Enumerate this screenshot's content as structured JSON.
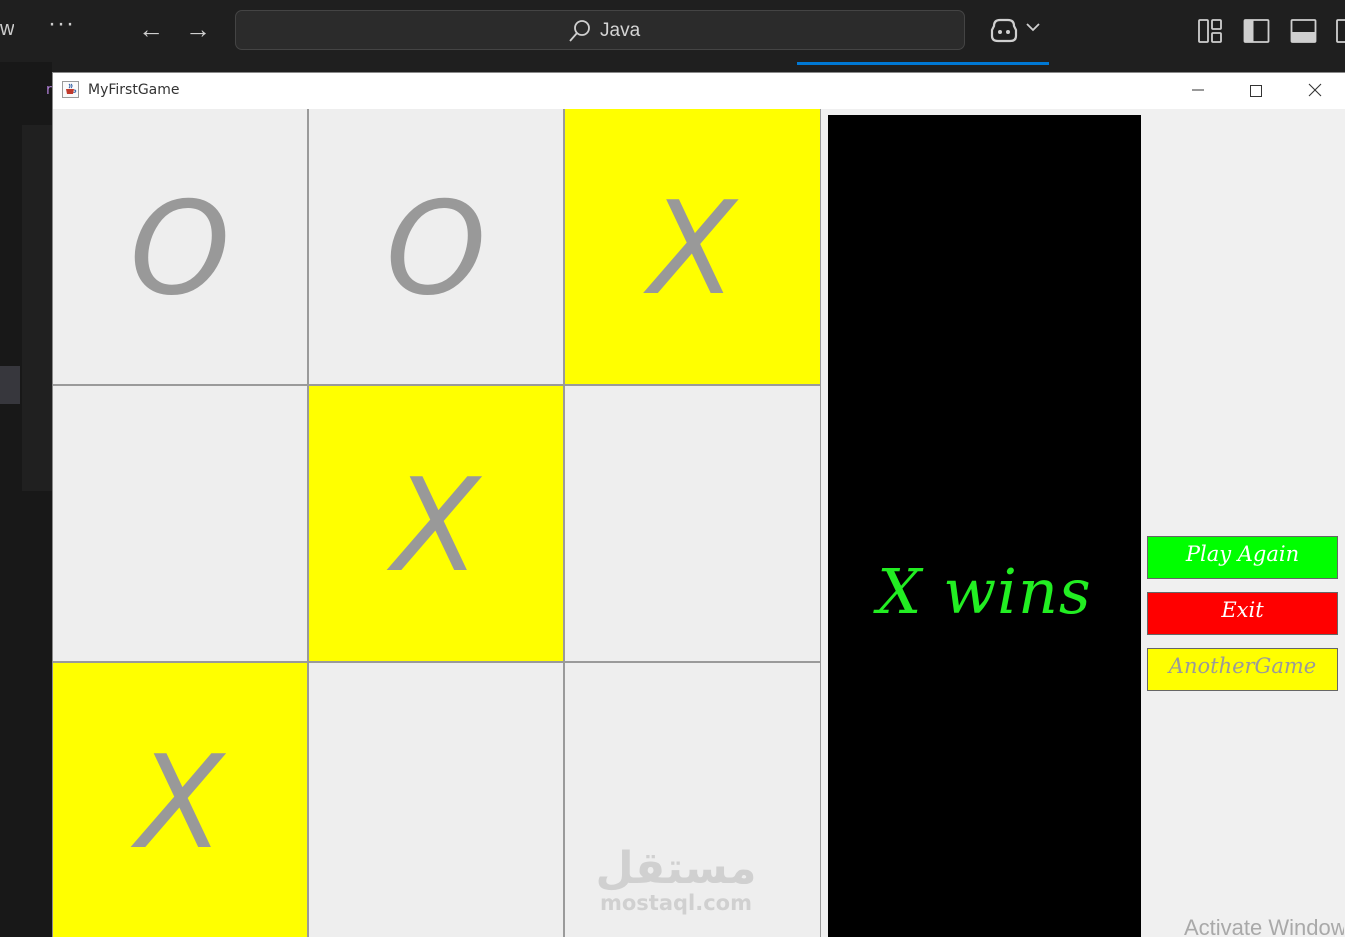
{
  "ide": {
    "menu_partial": "w",
    "more": "···",
    "back_arrow": "←",
    "forward_arrow": "→",
    "search_text": "Java",
    "menu_partial_right": "r"
  },
  "window": {
    "title": "MyFirstGame"
  },
  "board": {
    "cells": [
      {
        "mark": "O",
        "highlight": false
      },
      {
        "mark": "O",
        "highlight": false
      },
      {
        "mark": "X",
        "highlight": true
      },
      {
        "mark": "",
        "highlight": false
      },
      {
        "mark": "X",
        "highlight": true
      },
      {
        "mark": "",
        "highlight": false
      },
      {
        "mark": "X",
        "highlight": true
      },
      {
        "mark": "",
        "highlight": false
      },
      {
        "mark": "",
        "highlight": false
      }
    ],
    "highlight_color": "#ffff00",
    "empty_color": "#eeeeee",
    "mark_color": "#999999"
  },
  "result": {
    "text": "X wins",
    "text_color": "#22ee22",
    "background": "#000000"
  },
  "buttons": {
    "play_again": {
      "label": "Play Again",
      "bg": "#00ff00",
      "fg": "#ffffff"
    },
    "exit": {
      "label": "Exit",
      "bg": "#ff0000",
      "fg": "#ffffff"
    },
    "another_game": {
      "label": "AnotherGame",
      "bg": "#ffff00",
      "fg": "#9a9a9a"
    }
  },
  "overlay": {
    "watermark_arabic": "مستقل",
    "watermark_latin": "mostaql.com",
    "activate_windows": "Activate Windows"
  }
}
